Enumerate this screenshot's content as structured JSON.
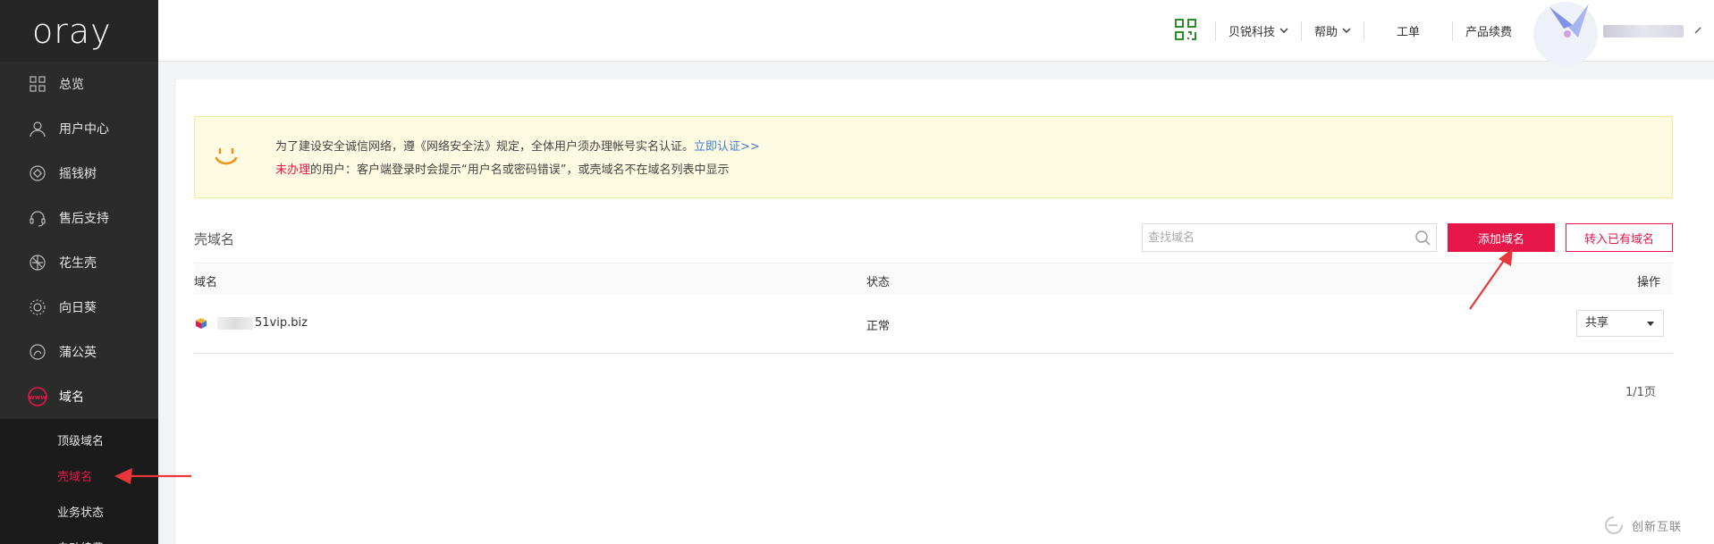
{
  "sidebar": {
    "logo": "oray",
    "items": [
      {
        "label": "总览",
        "icon": "grid-icon"
      },
      {
        "label": "用户中心",
        "icon": "user-icon"
      },
      {
        "label": "摇钱树",
        "icon": "diamond-icon"
      },
      {
        "label": "售后支持",
        "icon": "headset-icon"
      },
      {
        "label": "花生壳",
        "icon": "peanut-icon"
      },
      {
        "label": "向日葵",
        "icon": "sunflower-icon"
      },
      {
        "label": "蒲公英",
        "icon": "dandelion-icon"
      },
      {
        "label": "域名",
        "icon": "www-icon"
      }
    ],
    "sub_items": [
      {
        "label": "顶级域名"
      },
      {
        "label": "壳域名"
      },
      {
        "label": "业务状态"
      },
      {
        "label": "自动续费"
      }
    ],
    "active_color": "#e8174a"
  },
  "header": {
    "company": "贝锐科技",
    "help": "帮助",
    "ticket": "工单",
    "renew": "产品续费"
  },
  "notice": {
    "line1": "为了建设安全诚信网络，遵《网络安全法》规定，全体用户须办理帐号实名认证。",
    "link": "立即认证>>",
    "line2_red": "未办理",
    "line2_rest": "的用户：客户端登录时会提示“用户名或密码错误”，或壳域名不在域名列表中显示"
  },
  "section": {
    "title": "壳域名",
    "search_placeholder": "查找域名",
    "add_button": "添加域名",
    "transfer_button": "转入已有域名"
  },
  "table": {
    "headers": {
      "domain": "域名",
      "status": "状态",
      "action": "操作"
    },
    "rows": [
      {
        "domain": "51vip.biz",
        "status": "正常",
        "action": "共享"
      }
    ]
  },
  "pager": "1/1页",
  "watermark": "创新互联",
  "colors": {
    "accent": "#e8174a",
    "sidebar": "#2b2b2b",
    "notice_bg": "#fffbe2"
  }
}
